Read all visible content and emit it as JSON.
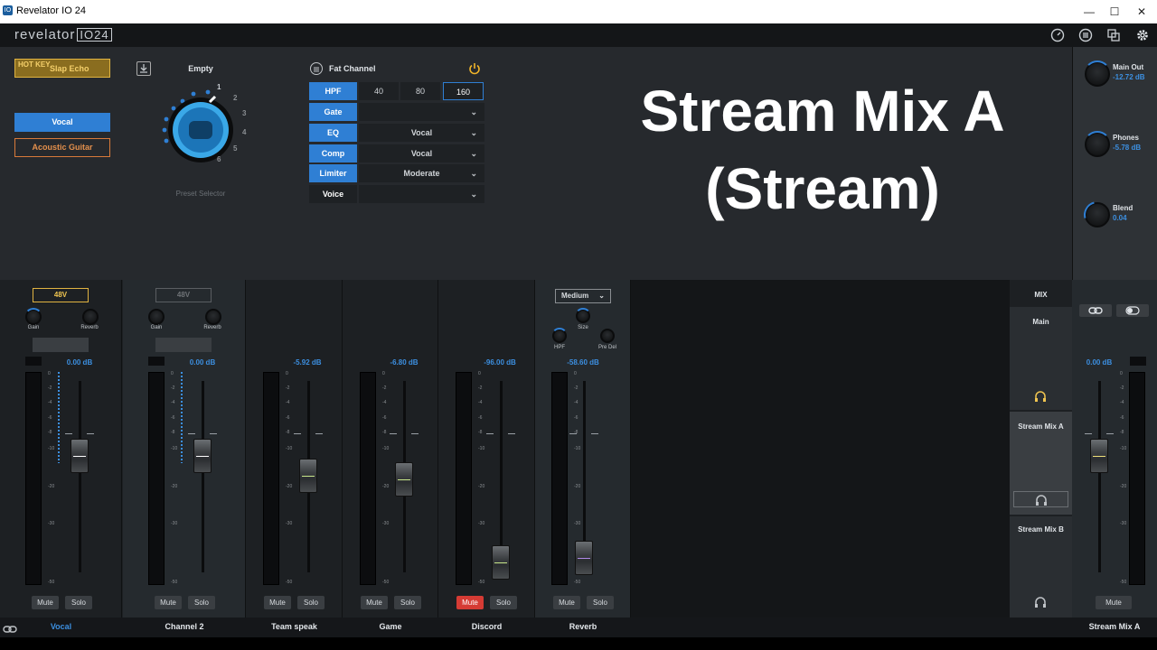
{
  "window": {
    "title": "Revelator IO 24",
    "controls": [
      "—",
      "☐",
      "✕"
    ]
  },
  "header": {
    "logo_text": "revelator",
    "logo_box": "IO24",
    "icons": [
      "gauge-icon",
      "mixer-icon",
      "copy-icon",
      "gear-icon"
    ]
  },
  "hotkey": {
    "label": "HOT KEY",
    "effect": "Slap Echo"
  },
  "presets": {
    "buttons": [
      "Vocal",
      "Acoustic Guitar"
    ],
    "slot_name": "Empty",
    "selector_label": "Preset Selector",
    "knob_marks": [
      "1",
      "2",
      "3",
      "4",
      "5",
      "6"
    ]
  },
  "fatchannel": {
    "title": "Fat Channel",
    "rows": [
      {
        "label": "HPF",
        "active": true,
        "options": [
          "40",
          "80",
          "160"
        ],
        "selected": "160"
      },
      {
        "label": "Gate",
        "active": true,
        "value": ""
      },
      {
        "label": "EQ",
        "active": true,
        "value": "Vocal"
      },
      {
        "label": "Comp",
        "active": true,
        "value": "Vocal"
      },
      {
        "label": "Limiter",
        "active": true,
        "value": "Moderate"
      },
      {
        "label": "Voice",
        "active": false,
        "value": ""
      }
    ]
  },
  "overlay": {
    "line1": "Stream Mix A",
    "line2": "(Stream)"
  },
  "outputs": [
    {
      "label": "Main Out",
      "value": "-12.72 dB"
    },
    {
      "label": "Phones",
      "value": "-5.78 dB"
    },
    {
      "label": "Blend",
      "value": "0.04"
    }
  ],
  "scale": [
    "0",
    "-2",
    "-4",
    "-6",
    "-8",
    "-10",
    "-20",
    "-30",
    "-50"
  ],
  "channels": [
    {
      "name": "Vocal",
      "db": "0.00 dB",
      "phantom": "48V",
      "phantom_on": true,
      "gain": "Gain",
      "reverb": "Reverb",
      "mute": "Mute",
      "solo": "Solo",
      "muted": false,
      "level": 0.68
    },
    {
      "name": "Channel 2",
      "db": "0.00 dB",
      "phantom": "48V",
      "phantom_on": false,
      "gain": "Gain",
      "reverb": "Reverb",
      "mute": "Mute",
      "solo": "Solo",
      "muted": false,
      "level": 0.68
    },
    {
      "name": "Team speak",
      "db": "-5.92 dB",
      "mute": "Mute",
      "solo": "Solo",
      "muted": false,
      "level": 0.55
    },
    {
      "name": "Game",
      "db": "-6.80 dB",
      "mute": "Mute",
      "solo": "Solo",
      "muted": false,
      "level": 0.53
    },
    {
      "name": "Discord",
      "db": "-96.00 dB",
      "mute": "Mute",
      "solo": "Solo",
      "muted": true,
      "level": 0.0
    },
    {
      "name": "Reverb",
      "db": "-58.60 dB",
      "mute": "Mute",
      "solo": "Solo",
      "muted": false,
      "level": 0.03,
      "room": "Medium",
      "size": "Size",
      "hpf": "HPF",
      "predel": "Pre Del"
    }
  ],
  "mix": {
    "title": "MIX",
    "zones": [
      "Main",
      "Stream Mix A",
      "Stream Mix B"
    ]
  },
  "master": {
    "name": "Stream Mix A",
    "db": "0.00 dB",
    "mute": "Mute",
    "level": 0.68
  }
}
